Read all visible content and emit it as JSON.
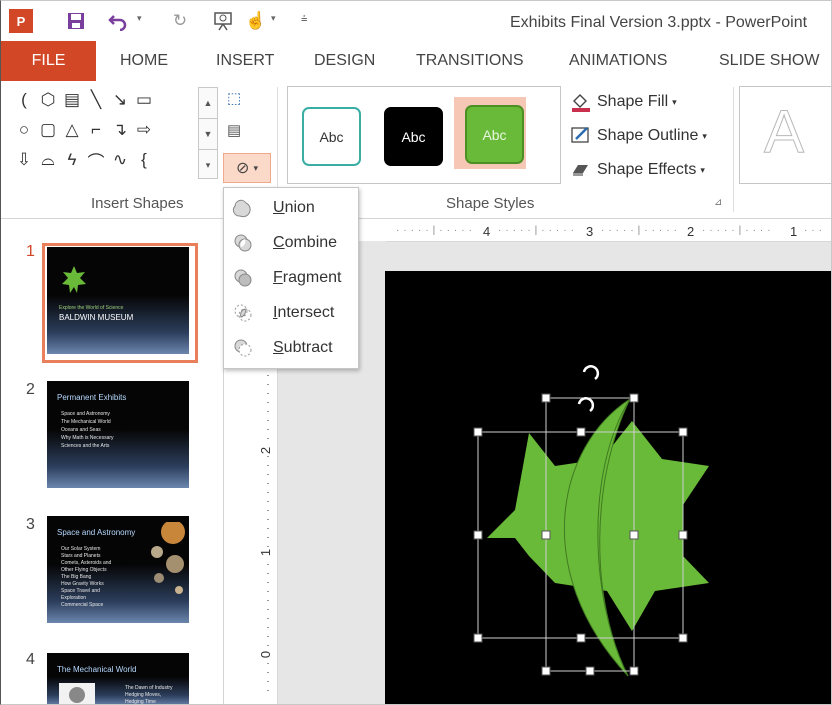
{
  "window": {
    "title": "Exhibits Final Version 3.pptx - PowerPoint",
    "logo_text": "P"
  },
  "tabs": [
    "FILE",
    "HOME",
    "INSERT",
    "DESIGN",
    "TRANSITIONS",
    "ANIMATIONS",
    "SLIDE SHOW"
  ],
  "ribbon": {
    "insert_shapes_label": "Insert Shapes",
    "shape_styles_label": "Shape Styles",
    "style_presets": [
      "Abc",
      "Abc",
      "Abc"
    ],
    "shape_fill": "Shape Fill",
    "shape_outline": "Shape Outline",
    "shape_effects": "Shape Effects",
    "wordart_letter": "A"
  },
  "merge_shapes_menu": [
    "Union",
    "Combine",
    "Fragment",
    "Intersect",
    "Subtract"
  ],
  "slides": [
    {
      "number": "1",
      "title": "BALDWIN MUSEUM",
      "subtitle": "Explore the World of Science",
      "bullets": []
    },
    {
      "number": "2",
      "title": "Permanent Exhibits",
      "bullets": [
        "Space and Astronomy",
        "The Mechanical World",
        "Oceans and Seas",
        "Why Math is Necessary",
        "Sciences and the Arts"
      ]
    },
    {
      "number": "3",
      "title": "Space and Astronomy",
      "bullets": [
        "Our Solar System",
        "Stars and Planets",
        "Comets, Asteroids and",
        "Other Flying Objects",
        "The Big Bang",
        "How Gravity Works",
        "Space Travel and",
        "Exploration",
        "Commercial Space"
      ]
    },
    {
      "number": "4",
      "title": "The Mechanical World",
      "bullets": [
        "The Dawn of Industry",
        "Hedging Moves,",
        "Hedging Time"
      ]
    }
  ],
  "ruler": {
    "horizontal": [
      "4",
      "3",
      "2",
      "1"
    ],
    "vertical": [
      "2",
      "1",
      "0"
    ]
  },
  "colors": {
    "accent": "#d24726",
    "shape_fill": "#6aba39",
    "slide_bg": "#000000"
  }
}
